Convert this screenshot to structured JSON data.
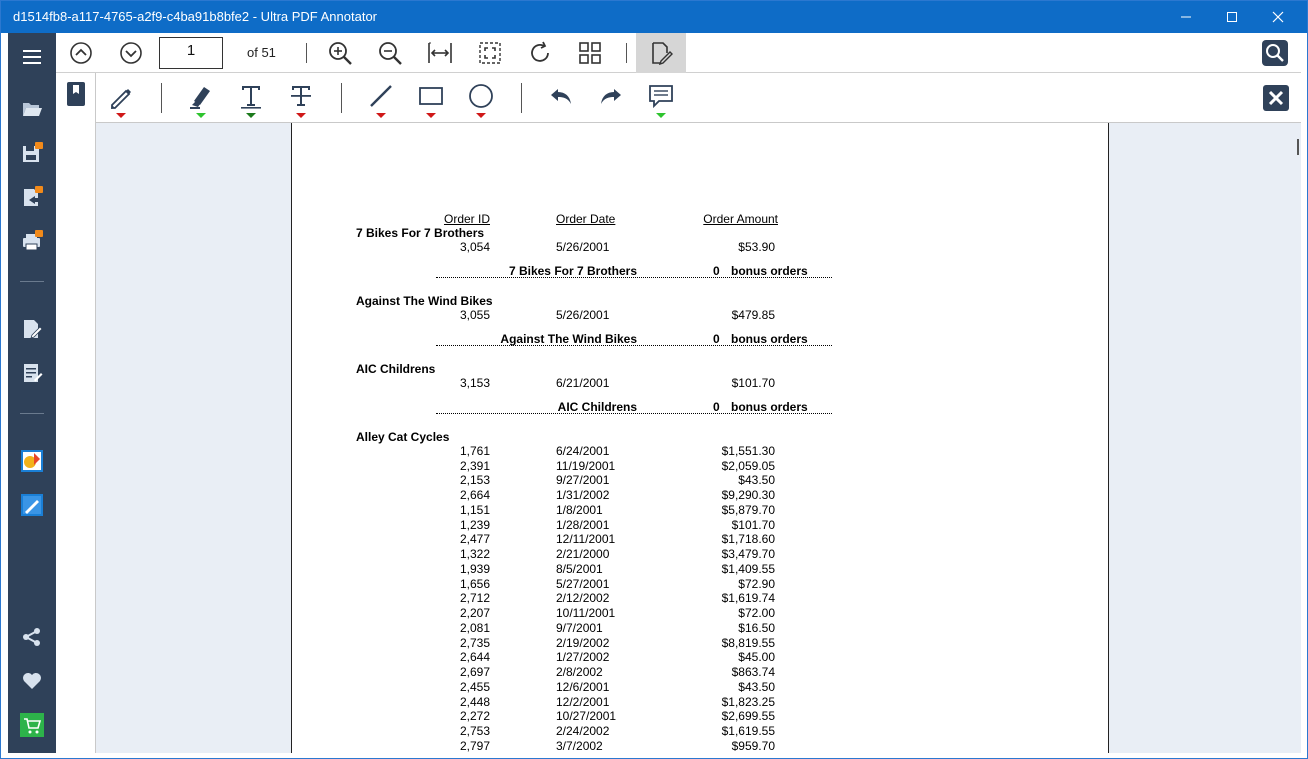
{
  "window": {
    "title": "d1514fb8-a117-4765-a2f9-c4ba91b8bfe2 - Ultra PDF Annotator"
  },
  "toolbar": {
    "page_number": "1",
    "page_of": "of 51"
  },
  "report": {
    "headers": {
      "order_id": "Order ID",
      "order_date": "Order Date",
      "order_amount": "Order Amount"
    },
    "groups": [
      {
        "name": "7 Bikes For 7 Brothers",
        "rows": [
          {
            "id": "3,054",
            "date": "5/26/2001",
            "amount": "$53.90"
          }
        ],
        "summary": {
          "name": "7 Bikes For 7 Brothers",
          "count": "0",
          "label": "bonus orders"
        }
      },
      {
        "name": "Against The Wind Bikes",
        "rows": [
          {
            "id": "3,055",
            "date": "5/26/2001",
            "amount": "$479.85"
          }
        ],
        "summary": {
          "name": "Against The Wind Bikes",
          "count": "0",
          "label": "bonus orders"
        }
      },
      {
        "name": "AIC Childrens",
        "rows": [
          {
            "id": "3,153",
            "date": "6/21/2001",
            "amount": "$101.70"
          }
        ],
        "summary": {
          "name": "AIC Childrens",
          "count": "0",
          "label": "bonus orders"
        }
      },
      {
        "name": "Alley Cat Cycles",
        "rows": [
          {
            "id": "1,761",
            "date": "6/24/2001",
            "amount": "$1,551.30"
          },
          {
            "id": "2,391",
            "date": "11/19/2001",
            "amount": "$2,059.05"
          },
          {
            "id": "2,153",
            "date": "9/27/2001",
            "amount": "$43.50"
          },
          {
            "id": "2,664",
            "date": "1/31/2002",
            "amount": "$9,290.30"
          },
          {
            "id": "1,151",
            "date": "1/8/2001",
            "amount": "$5,879.70"
          },
          {
            "id": "1,239",
            "date": "1/28/2001",
            "amount": "$101.70"
          },
          {
            "id": "2,477",
            "date": "12/11/2001",
            "amount": "$1,718.60"
          },
          {
            "id": "1,322",
            "date": "2/21/2000",
            "amount": "$3,479.70"
          },
          {
            "id": "1,939",
            "date": "8/5/2001",
            "amount": "$1,409.55"
          },
          {
            "id": "1,656",
            "date": "5/27/2001",
            "amount": "$72.90"
          },
          {
            "id": "2,712",
            "date": "2/12/2002",
            "amount": "$1,619.74"
          },
          {
            "id": "2,207",
            "date": "10/11/2001",
            "amount": "$72.00"
          },
          {
            "id": "2,081",
            "date": "9/7/2001",
            "amount": "$16.50"
          },
          {
            "id": "2,735",
            "date": "2/19/2002",
            "amount": "$8,819.55"
          },
          {
            "id": "2,644",
            "date": "1/27/2002",
            "amount": "$45.00"
          },
          {
            "id": "2,697",
            "date": "2/8/2002",
            "amount": "$863.74"
          },
          {
            "id": "2,455",
            "date": "12/6/2001",
            "amount": "$43.50"
          },
          {
            "id": "2,448",
            "date": "12/2/2001",
            "amount": "$1,823.25"
          },
          {
            "id": "2,272",
            "date": "10/27/2001",
            "amount": "$2,699.55"
          },
          {
            "id": "2,753",
            "date": "2/24/2002",
            "amount": "$1,619.55"
          },
          {
            "id": "2,797",
            "date": "3/7/2002",
            "amount": "$959.70"
          }
        ]
      }
    ]
  },
  "colors": {
    "titlebar": "#0e6cc7",
    "sidebar": "#2f4159",
    "content_bg": "#e9eef5",
    "red_marker": "#d01818",
    "green_marker": "#2ec42e"
  },
  "icons": {
    "sidebar": [
      "hamburger-menu-icon",
      "open-folder-icon",
      "save-locked-icon",
      "export-locked-icon",
      "print-locked-icon",
      "edit-document-icon",
      "form-fill-icon",
      "color-palette-icon",
      "pen-app-icon",
      "share-icon",
      "heart-icon",
      "shopping-cart-icon"
    ],
    "toolbar": [
      "page-up-icon",
      "page-down-icon",
      "zoom-in-icon",
      "zoom-out-icon",
      "fit-width-icon",
      "fit-page-icon",
      "rotate-icon",
      "thumbnails-icon",
      "annotate-mode-icon",
      "search-icon"
    ],
    "annotation": [
      "bookmark-icon",
      "pen-icon",
      "highlighter-icon",
      "text-icon",
      "strikethrough-text-icon",
      "line-icon",
      "rectangle-icon",
      "ellipse-icon",
      "undo-icon",
      "redo-icon",
      "comment-icon",
      "close-annotation-icon"
    ]
  }
}
